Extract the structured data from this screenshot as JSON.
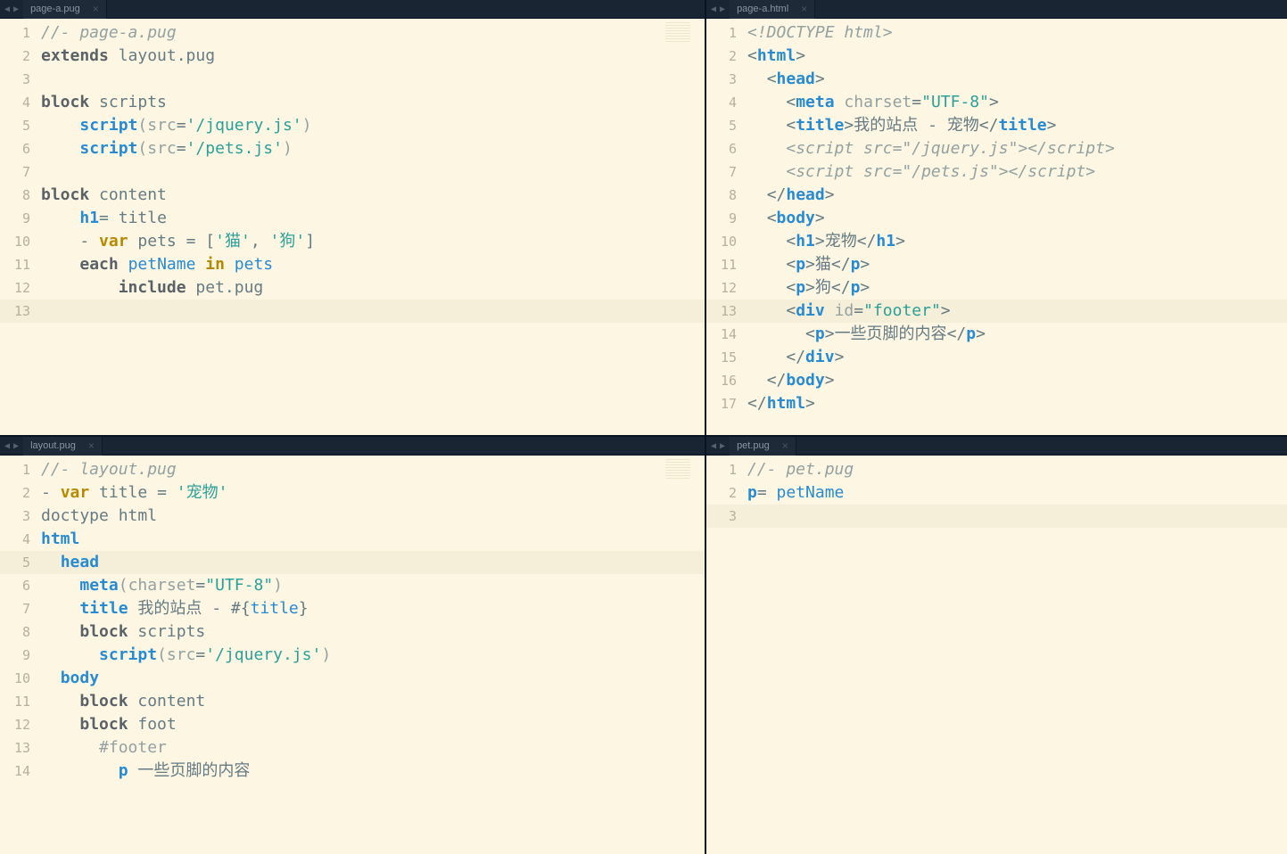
{
  "tabs": {
    "tl": "page-a.pug",
    "tr": "page-a.html",
    "bl": "layout.pug",
    "br": "pet.pug"
  },
  "panes": {
    "tl": {
      "lines": 13,
      "highlight": 13,
      "code": [
        [
          [
            "c-comment",
            "//- page-a.pug"
          ]
        ],
        [
          [
            "c-kw",
            "extends"
          ],
          [
            "c-plain",
            " layout.pug"
          ]
        ],
        [],
        [
          [
            "c-kw",
            "block"
          ],
          [
            "c-plain",
            " scripts"
          ]
        ],
        [
          [
            "c-plain",
            "    "
          ],
          [
            "c-tag",
            "script"
          ],
          [
            "c-attr",
            "("
          ],
          [
            "c-attr",
            "src"
          ],
          [
            "c-op",
            "="
          ],
          [
            "c-str",
            "'/jquery.js'"
          ],
          [
            "c-attr",
            ")"
          ]
        ],
        [
          [
            "c-plain",
            "    "
          ],
          [
            "c-tag",
            "script"
          ],
          [
            "c-attr",
            "("
          ],
          [
            "c-attr",
            "src"
          ],
          [
            "c-op",
            "="
          ],
          [
            "c-str",
            "'/pets.js'"
          ],
          [
            "c-attr",
            ")"
          ]
        ],
        [],
        [
          [
            "c-kw",
            "block"
          ],
          [
            "c-plain",
            " content"
          ]
        ],
        [
          [
            "c-plain",
            "    "
          ],
          [
            "c-tag",
            "h1"
          ],
          [
            "c-op",
            "= "
          ],
          [
            "c-plain",
            "title"
          ]
        ],
        [
          [
            "c-plain",
            "    "
          ],
          [
            "c-op",
            "- "
          ],
          [
            "c-kw2",
            "var"
          ],
          [
            "c-plain",
            " pets "
          ],
          [
            "c-op",
            "="
          ],
          [
            "c-plain",
            " ["
          ],
          [
            "c-str",
            "'猫'"
          ],
          [
            "c-plain",
            ", "
          ],
          [
            "c-str",
            "'狗'"
          ],
          [
            "c-plain",
            "]"
          ]
        ],
        [
          [
            "c-plain",
            "    "
          ],
          [
            "c-kw",
            "each"
          ],
          [
            "c-plain",
            " "
          ],
          [
            "c-var",
            "petName"
          ],
          [
            "c-plain",
            " "
          ],
          [
            "c-kw2",
            "in"
          ],
          [
            "c-plain",
            " "
          ],
          [
            "c-var",
            "pets"
          ]
        ],
        [
          [
            "c-plain",
            "        "
          ],
          [
            "c-kw",
            "include"
          ],
          [
            "c-plain",
            " pet.pug"
          ]
        ],
        []
      ]
    },
    "tr": {
      "lines": 17,
      "highlight": 13,
      "code": [
        [
          [
            "c-doctype",
            "<!DOCTYPE html>"
          ]
        ],
        [
          [
            "c-punct",
            "<"
          ],
          [
            "c-tag",
            "html"
          ],
          [
            "c-punct",
            ">"
          ]
        ],
        [
          [
            "c-plain",
            "  "
          ],
          [
            "c-punct",
            "<"
          ],
          [
            "c-tag",
            "head"
          ],
          [
            "c-punct",
            ">"
          ]
        ],
        [
          [
            "c-plain",
            "    "
          ],
          [
            "c-punct",
            "<"
          ],
          [
            "c-tag",
            "meta"
          ],
          [
            "c-plain",
            " "
          ],
          [
            "c-attr",
            "charset"
          ],
          [
            "c-op",
            "="
          ],
          [
            "c-str",
            "\"UTF-8\""
          ],
          [
            "c-punct",
            ">"
          ]
        ],
        [
          [
            "c-plain",
            "    "
          ],
          [
            "c-punct",
            "<"
          ],
          [
            "c-tag",
            "title"
          ],
          [
            "c-punct",
            ">"
          ],
          [
            "c-plain",
            "我的站点 - 宠物"
          ],
          [
            "c-punct",
            "</"
          ],
          [
            "c-tag",
            "title"
          ],
          [
            "c-punct",
            ">"
          ]
        ],
        [
          [
            "c-plain",
            "    "
          ],
          [
            "c-doctype",
            "<script src=\"/jquery.js\"></script>"
          ]
        ],
        [
          [
            "c-plain",
            "    "
          ],
          [
            "c-doctype",
            "<script src=\"/pets.js\"></script>"
          ]
        ],
        [
          [
            "c-plain",
            "  "
          ],
          [
            "c-punct",
            "</"
          ],
          [
            "c-tag",
            "head"
          ],
          [
            "c-punct",
            ">"
          ]
        ],
        [
          [
            "c-plain",
            "  "
          ],
          [
            "c-punct",
            "<"
          ],
          [
            "c-tag",
            "body"
          ],
          [
            "c-punct",
            ">"
          ]
        ],
        [
          [
            "c-plain",
            "    "
          ],
          [
            "c-punct",
            "<"
          ],
          [
            "c-tag",
            "h1"
          ],
          [
            "c-punct",
            ">"
          ],
          [
            "c-plain",
            "宠物"
          ],
          [
            "c-punct",
            "</"
          ],
          [
            "c-tag",
            "h1"
          ],
          [
            "c-punct",
            ">"
          ]
        ],
        [
          [
            "c-plain",
            "    "
          ],
          [
            "c-punct",
            "<"
          ],
          [
            "c-tag",
            "p"
          ],
          [
            "c-punct",
            ">"
          ],
          [
            "c-plain",
            "猫"
          ],
          [
            "c-punct",
            "</"
          ],
          [
            "c-tag",
            "p"
          ],
          [
            "c-punct",
            ">"
          ]
        ],
        [
          [
            "c-plain",
            "    "
          ],
          [
            "c-punct",
            "<"
          ],
          [
            "c-tag",
            "p"
          ],
          [
            "c-punct",
            ">"
          ],
          [
            "c-plain",
            "狗"
          ],
          [
            "c-punct",
            "</"
          ],
          [
            "c-tag",
            "p"
          ],
          [
            "c-punct",
            ">"
          ]
        ],
        [
          [
            "c-plain",
            "    "
          ],
          [
            "c-punct",
            "<"
          ],
          [
            "c-tag",
            "div"
          ],
          [
            "c-plain",
            " "
          ],
          [
            "c-attr",
            "id"
          ],
          [
            "c-op",
            "="
          ],
          [
            "c-str",
            "\"footer\""
          ],
          [
            "c-punct",
            ">"
          ]
        ],
        [
          [
            "c-plain",
            "      "
          ],
          [
            "c-punct",
            "<"
          ],
          [
            "c-tag",
            "p"
          ],
          [
            "c-punct",
            ">"
          ],
          [
            "c-plain",
            "一些页脚的内容"
          ],
          [
            "c-punct",
            "</"
          ],
          [
            "c-tag",
            "p"
          ],
          [
            "c-punct",
            ">"
          ]
        ],
        [
          [
            "c-plain",
            "    "
          ],
          [
            "c-punct",
            "</"
          ],
          [
            "c-tag",
            "div"
          ],
          [
            "c-punct",
            ">"
          ]
        ],
        [
          [
            "c-plain",
            "  "
          ],
          [
            "c-punct",
            "</"
          ],
          [
            "c-tag",
            "body"
          ],
          [
            "c-punct",
            ">"
          ]
        ],
        [
          [
            "c-punct",
            "</"
          ],
          [
            "c-tag",
            "html"
          ],
          [
            "c-punct",
            ">"
          ]
        ]
      ]
    },
    "bl": {
      "lines": 14,
      "highlight": 5,
      "code": [
        [
          [
            "c-comment",
            "//- layout.pug"
          ]
        ],
        [
          [
            "c-op",
            "- "
          ],
          [
            "c-kw2",
            "var"
          ],
          [
            "c-plain",
            " title "
          ],
          [
            "c-op",
            "="
          ],
          [
            "c-plain",
            " "
          ],
          [
            "c-str",
            "'宠物'"
          ]
        ],
        [
          [
            "c-plain",
            "doctype html"
          ]
        ],
        [
          [
            "c-tag",
            "html"
          ]
        ],
        [
          [
            "c-plain",
            "  "
          ],
          [
            "c-tag",
            "head"
          ]
        ],
        [
          [
            "c-plain",
            "    "
          ],
          [
            "c-tag",
            "meta"
          ],
          [
            "c-attr",
            "("
          ],
          [
            "c-attr",
            "charset"
          ],
          [
            "c-op",
            "="
          ],
          [
            "c-str",
            "\"UTF-8\""
          ],
          [
            "c-attr",
            ")"
          ]
        ],
        [
          [
            "c-plain",
            "    "
          ],
          [
            "c-tag",
            "title"
          ],
          [
            "c-plain",
            " 我的站点 - #{"
          ],
          [
            "c-var",
            "title"
          ],
          [
            "c-plain",
            "}"
          ]
        ],
        [
          [
            "c-plain",
            "    "
          ],
          [
            "c-kw",
            "block"
          ],
          [
            "c-plain",
            " scripts"
          ]
        ],
        [
          [
            "c-plain",
            "      "
          ],
          [
            "c-tag",
            "script"
          ],
          [
            "c-attr",
            "("
          ],
          [
            "c-attr",
            "src"
          ],
          [
            "c-op",
            "="
          ],
          [
            "c-str",
            "'/jquery.js'"
          ],
          [
            "c-attr",
            ")"
          ]
        ],
        [
          [
            "c-plain",
            "  "
          ],
          [
            "c-tag",
            "body"
          ]
        ],
        [
          [
            "c-plain",
            "    "
          ],
          [
            "c-kw",
            "block"
          ],
          [
            "c-plain",
            " content"
          ]
        ],
        [
          [
            "c-plain",
            "    "
          ],
          [
            "c-kw",
            "block"
          ],
          [
            "c-plain",
            " foot"
          ]
        ],
        [
          [
            "c-plain",
            "      "
          ],
          [
            "c-attr",
            "#footer"
          ]
        ],
        [
          [
            "c-plain",
            "        "
          ],
          [
            "c-tag",
            "p"
          ],
          [
            "c-plain",
            " 一些页脚的内容"
          ]
        ]
      ]
    },
    "br": {
      "lines": 3,
      "highlight": 3,
      "code": [
        [
          [
            "c-comment",
            "//- pet.pug"
          ]
        ],
        [
          [
            "c-tag",
            "p"
          ],
          [
            "c-op",
            "= "
          ],
          [
            "c-var",
            "petName"
          ]
        ],
        []
      ]
    }
  }
}
